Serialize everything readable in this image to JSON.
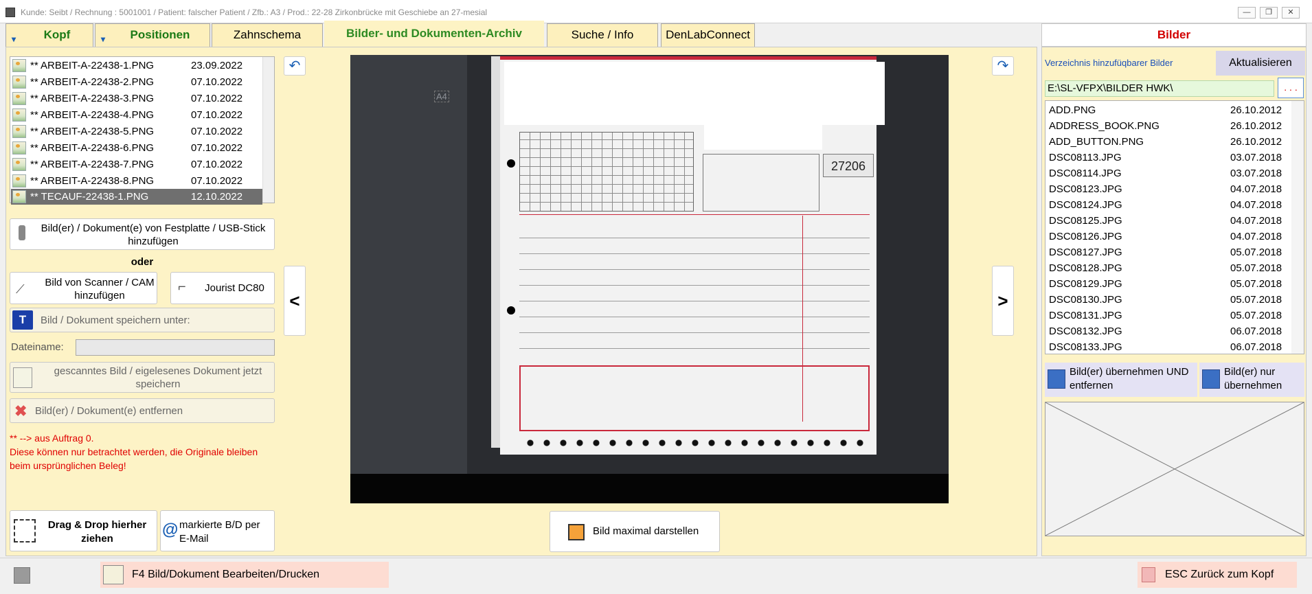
{
  "window": {
    "title": "Kunde: Seibt  / Rechnung :    5001001 / Patient: falscher Patient / Zfb.: A3 / Prod.: 22-28 Zirkonbrücke mit Geschiebe an 27-mesial",
    "minimize": "—",
    "maximize": "❐",
    "close": "✕"
  },
  "tabs": [
    {
      "label": "Kopf"
    },
    {
      "label": "Positionen"
    },
    {
      "label": "Zahnschema"
    },
    {
      "label": "Bilder- und Dokumenten-Archiv"
    },
    {
      "label": "Suche / Info"
    },
    {
      "label": "DenLabConnect"
    }
  ],
  "files": [
    {
      "name": "** ARBEIT-A-22438-1.PNG",
      "date": "23.09.2022"
    },
    {
      "name": "** ARBEIT-A-22438-2.PNG",
      "date": "07.10.2022"
    },
    {
      "name": "** ARBEIT-A-22438-3.PNG",
      "date": "07.10.2022"
    },
    {
      "name": "** ARBEIT-A-22438-4.PNG",
      "date": "07.10.2022"
    },
    {
      "name": "** ARBEIT-A-22438-5.PNG",
      "date": "07.10.2022"
    },
    {
      "name": "** ARBEIT-A-22438-6.PNG",
      "date": "07.10.2022"
    },
    {
      "name": "** ARBEIT-A-22438-7.PNG",
      "date": "07.10.2022"
    },
    {
      "name": "** ARBEIT-A-22438-8.PNG",
      "date": "07.10.2022"
    },
    {
      "name": "** TECAUF-22438-1.PNG",
      "date": "12.10.2022",
      "selected": true
    }
  ],
  "left": {
    "add_from_disk": "Bild(er) / Dokument(e) von Festplatte  / USB-Stick hinzufügen",
    "oder": "oder",
    "scanner": "Bild von Scanner / CAM hinzufügen",
    "jourist": "Jourist DC80",
    "save_under": "Bild / Dokument speichern unter:",
    "filename_label": "Dateiname:",
    "filename_value": "",
    "save_scanned": "gescanntes Bild / eigelesenes Dokument jetzt speichern",
    "remove": "Bild(er) / Dokument(e) entfernen",
    "note_line1": "** --> aus Auftrag 0.",
    "note_line2": "Diese können nur betrachtet werden, die Originale bleiben beim ursprünglichen Beleg!",
    "drag_drop": "Drag & Drop hierher ziehen",
    "email": "markierte B/D per E-Mail"
  },
  "preview": {
    "prev": "<",
    "next": ">",
    "maximize_button": "Bild maximal darstellen",
    "doc_number": "27206",
    "corner_label": "A4"
  },
  "right": {
    "header": "Bilder",
    "dir_label": "Verzeichnis hinzufüqbarer Bilder",
    "refresh": "Aktualisieren",
    "path": "E:\\SL-VFPX\\BILDER HWK\\",
    "browse": ". . .",
    "dir_files": [
      {
        "name": "ADD.PNG",
        "date": "26.10.2012"
      },
      {
        "name": "ADDRESS_BOOK.PNG",
        "date": "26.10.2012"
      },
      {
        "name": "ADD_BUTTON.PNG",
        "date": "26.10.2012"
      },
      {
        "name": "DSC08113.JPG",
        "date": "03.07.2018"
      },
      {
        "name": "DSC08114.JPG",
        "date": "03.07.2018"
      },
      {
        "name": "DSC08123.JPG",
        "date": "04.07.2018"
      },
      {
        "name": "DSC08124.JPG",
        "date": "04.07.2018"
      },
      {
        "name": "DSC08125.JPG",
        "date": "04.07.2018"
      },
      {
        "name": "DSC08126.JPG",
        "date": "04.07.2018"
      },
      {
        "name": "DSC08127.JPG",
        "date": "05.07.2018"
      },
      {
        "name": "DSC08128.JPG",
        "date": "05.07.2018"
      },
      {
        "name": "DSC08129.JPG",
        "date": "05.07.2018"
      },
      {
        "name": "DSC08130.JPG",
        "date": "05.07.2018"
      },
      {
        "name": "DSC08131.JPG",
        "date": "05.07.2018"
      },
      {
        "name": "DSC08132.JPG",
        "date": "06.07.2018"
      },
      {
        "name": "DSC08133.JPG",
        "date": "06.07.2018"
      }
    ],
    "take_and_remove": "Bild(er) übernehmen UND entfernen",
    "take_only": "Bild(er) nur übernehmen"
  },
  "bottom": {
    "f4": "F4 Bild/Dokument Bearbeiten/Drucken",
    "esc": "ESC Zurück zum Kopf"
  },
  "colors": {
    "panel": "#fdf3c6",
    "active_tab_text": "#2d8a22",
    "header_red": "#d20000",
    "note_red": "#e00000",
    "dir_label_blue": "#1a4fb8",
    "path_green": "#e6f8dc",
    "action_lavender": "#e4e2f4"
  }
}
